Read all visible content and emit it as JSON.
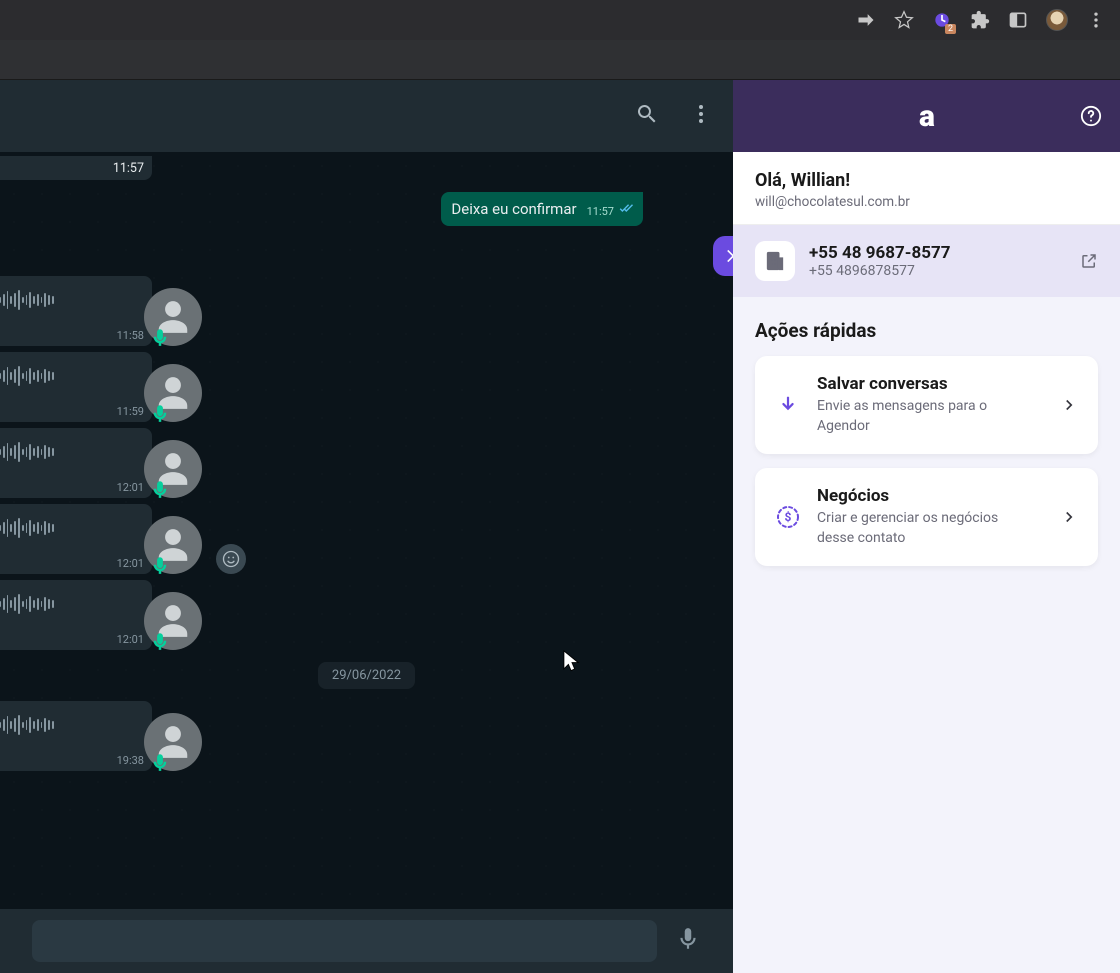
{
  "browser": {
    "ext_badge": "2"
  },
  "chat": {
    "top_time_stub": "11:57",
    "out_message": {
      "text": "Deixa eu confirmar",
      "time": "11:57"
    },
    "voices": [
      {
        "time": "11:58"
      },
      {
        "time": "11:59"
      },
      {
        "time": "12:01"
      },
      {
        "time": "12:01"
      },
      {
        "time": "12:01"
      }
    ],
    "date_divider": "29/06/2022",
    "after_divider_voice_time": "19:38"
  },
  "panel": {
    "logo": "a",
    "greeting": "Olá, Willian!",
    "email": "will@chocolatesul.com.br",
    "phone_display": "+55 48 9687-8577",
    "phone_raw": "+55 4896878577",
    "section_title": "Ações rápidas",
    "card1": {
      "title": "Salvar conversas",
      "desc": "Envie as mensagens para o Agendor"
    },
    "card2": {
      "title": "Negócios",
      "desc": "Criar e gerenciar os negócios desse contato"
    }
  }
}
